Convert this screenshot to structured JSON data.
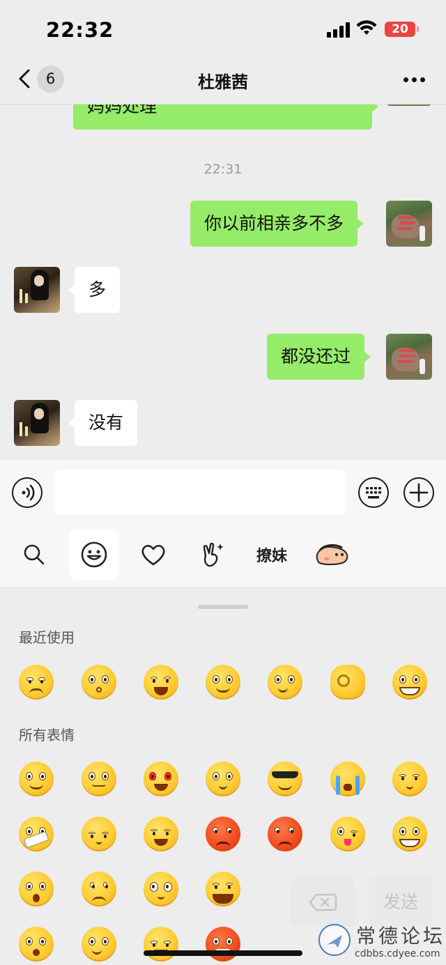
{
  "status": {
    "time": "22:32",
    "battery": "20"
  },
  "nav": {
    "back_count": "6",
    "title": "杜雅茜"
  },
  "chat": {
    "messages": [
      {
        "side": "me",
        "text": "妈妈处理"
      },
      {
        "timestamp": "22:31"
      },
      {
        "side": "me",
        "text": "你以前相亲多不多"
      },
      {
        "side": "them",
        "text": "多"
      },
      {
        "side": "me",
        "text": "都没还过"
      },
      {
        "side": "them",
        "text": "没有"
      }
    ]
  },
  "input": {
    "value": "",
    "placeholder": ""
  },
  "emoji_tabs": [
    {
      "icon": "search-icon"
    },
    {
      "icon": "smiley-icon",
      "selected": true
    },
    {
      "icon": "heart-icon"
    },
    {
      "icon": "victory-hand-icon"
    },
    {
      "label": "撩妹"
    },
    {
      "icon": "crayon-shin-chan-icon"
    }
  ],
  "emoji_panel": {
    "recent_title": "最近使用",
    "all_title": "所有表情",
    "delete_label": "⌫",
    "send_label": "发送"
  },
  "watermark": {
    "name": "常德论坛",
    "url": "cdbbs.cdyee.com"
  },
  "colors": {
    "my_bubble": "#95ec69",
    "their_bubble": "#ffffff",
    "background": "#ededed",
    "battery": "#e9463f"
  }
}
